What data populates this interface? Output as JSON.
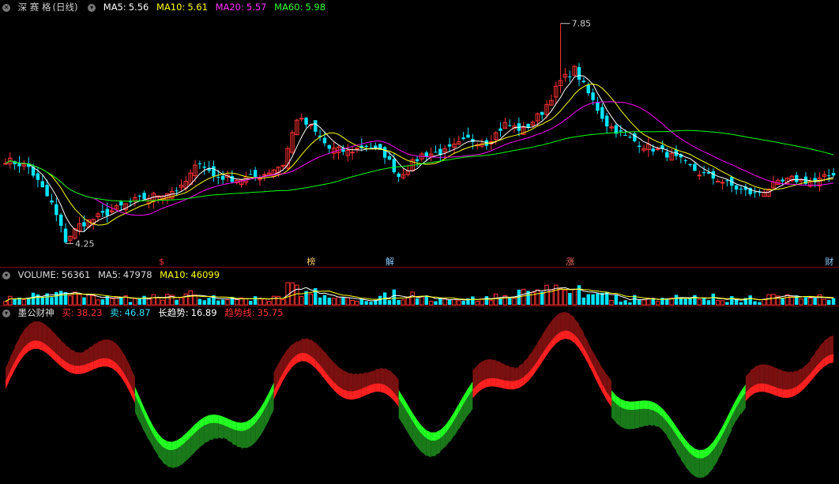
{
  "price_header": {
    "name": "深 赛 格",
    "period": "(日线)",
    "ma5_label": "MA5:",
    "ma5": "5.56",
    "ma10_label": "MA10:",
    "ma10": "5.61",
    "ma20_label": "MA20:",
    "ma20": "5.57",
    "ma60_label": "MA60:",
    "ma60": "5.98"
  },
  "price_marks": {
    "high": "7.85",
    "low": "4.25"
  },
  "event_markers": [
    "$",
    "榜",
    "解",
    "涨",
    "财"
  ],
  "volume_header": {
    "label": "VOLUME:",
    "value": "56361",
    "ma5_label": "MA5:",
    "ma5": "47978",
    "ma10_label": "MA10:",
    "ma10": "46099"
  },
  "indicator_header": {
    "name": "墨公财神",
    "buy_label": "买:",
    "buy": "38.23",
    "sell_label": "卖:",
    "sell": "46.87",
    "trend_label": "长趋势:",
    "trend": "16.89",
    "trendline_label": "趋势线:",
    "trendline": "35.75"
  },
  "colors": {
    "up": "#ff3333",
    "down": "#00e5ff",
    "ma5": "#ffffff",
    "ma10": "#ffff00",
    "ma20": "#ff00ff",
    "ma60": "#00ff00",
    "separator": "#8a0000",
    "buy_fill": "#ff2020",
    "buy_dark": "#7a1010",
    "sell_fill": "#22ff22",
    "sell_dark": "#1a7a1a"
  },
  "chart_data": {
    "type": "candlestick",
    "title": "深 赛 格 (日线)",
    "price_range": [
      4.25,
      7.85
    ],
    "series_names": [
      "MA5",
      "MA10",
      "MA20",
      "MA60"
    ],
    "anchor_closes": [
      [
        0,
        5.62
      ],
      [
        5,
        5.5
      ],
      [
        10,
        4.9
      ],
      [
        13,
        4.3
      ],
      [
        16,
        4.55
      ],
      [
        22,
        4.75
      ],
      [
        28,
        4.95
      ],
      [
        33,
        5.05
      ],
      [
        38,
        5.15
      ],
      [
        42,
        5.6
      ],
      [
        45,
        5.35
      ],
      [
        50,
        5.3
      ],
      [
        55,
        5.35
      ],
      [
        60,
        5.55
      ],
      [
        63,
        6.3
      ],
      [
        66,
        6.15
      ],
      [
        70,
        5.8
      ],
      [
        74,
        5.75
      ],
      [
        78,
        5.85
      ],
      [
        82,
        5.7
      ],
      [
        85,
        5.35
      ],
      [
        90,
        5.7
      ],
      [
        95,
        5.75
      ],
      [
        100,
        5.95
      ],
      [
        104,
        5.9
      ],
      [
        108,
        6.2
      ],
      [
        112,
        6.1
      ],
      [
        116,
        6.4
      ],
      [
        120,
        6.9
      ],
      [
        123,
        7.1
      ],
      [
        126,
        6.7
      ],
      [
        130,
        6.2
      ],
      [
        134,
        6.0
      ],
      [
        138,
        5.85
      ],
      [
        142,
        5.75
      ],
      [
        146,
        5.6
      ],
      [
        150,
        5.4
      ],
      [
        154,
        5.3
      ],
      [
        158,
        5.15
      ],
      [
        162,
        5.05
      ],
      [
        166,
        5.2
      ],
      [
        170,
        5.3
      ],
      [
        175,
        5.25
      ],
      [
        179,
        5.4
      ]
    ],
    "volume_values_relative": "derived",
    "indicator_series": [
      "买",
      "卖",
      "长趋势",
      "趋势线"
    ]
  }
}
